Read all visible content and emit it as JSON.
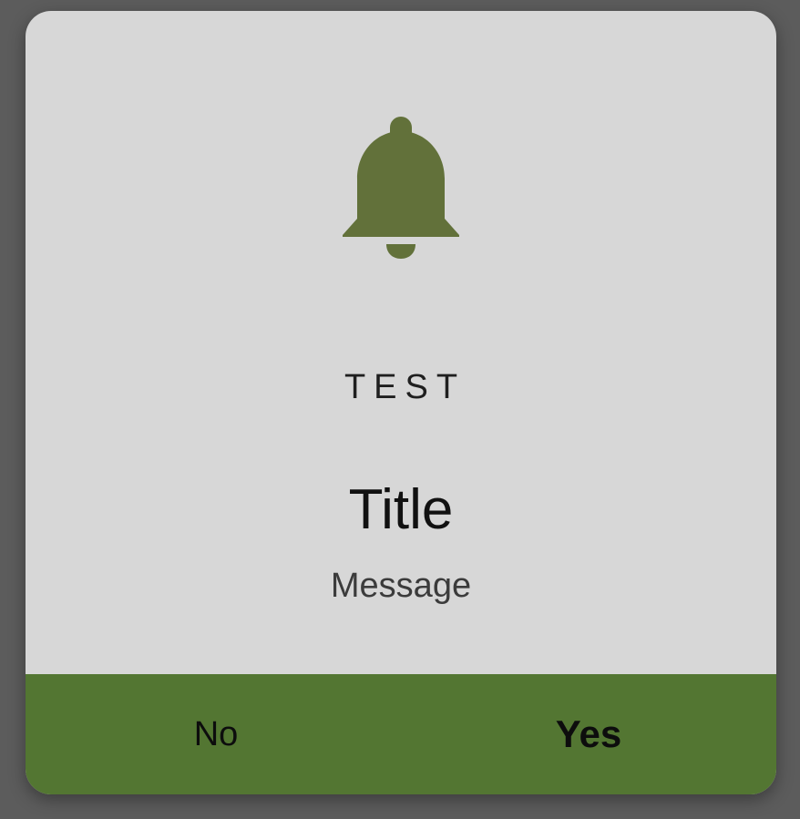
{
  "dialog": {
    "icon": "bell-icon",
    "tag": "TEST",
    "title": "Title",
    "message": "Message",
    "buttons": {
      "no_label": "No",
      "yes_label": "Yes"
    }
  },
  "colors": {
    "accent": "#537632",
    "icon": "#62713a",
    "dialog_background": "#d7d7d7",
    "backdrop": "#5c5c5c"
  }
}
